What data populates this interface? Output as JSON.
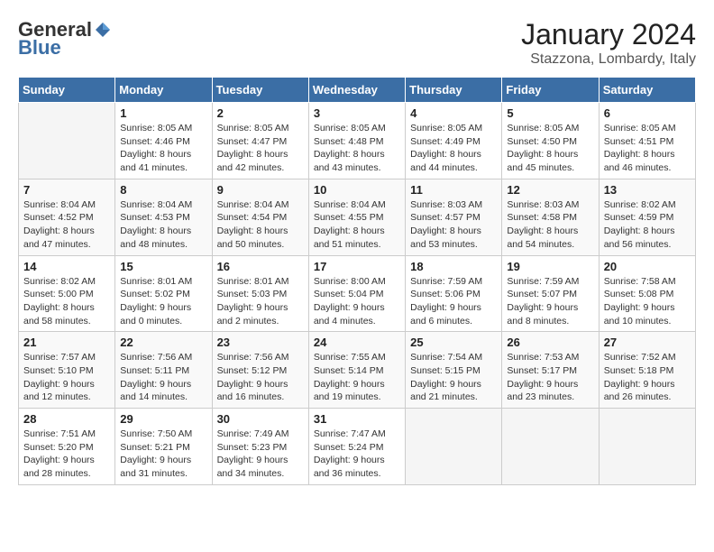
{
  "logo": {
    "general": "General",
    "blue": "Blue"
  },
  "title": "January 2024",
  "location": "Stazzona, Lombardy, Italy",
  "days_header": [
    "Sunday",
    "Monday",
    "Tuesday",
    "Wednesday",
    "Thursday",
    "Friday",
    "Saturday"
  ],
  "weeks": [
    [
      {
        "day": "",
        "sunrise": "",
        "sunset": "",
        "daylight": ""
      },
      {
        "day": "1",
        "sunrise": "Sunrise: 8:05 AM",
        "sunset": "Sunset: 4:46 PM",
        "daylight": "Daylight: 8 hours and 41 minutes."
      },
      {
        "day": "2",
        "sunrise": "Sunrise: 8:05 AM",
        "sunset": "Sunset: 4:47 PM",
        "daylight": "Daylight: 8 hours and 42 minutes."
      },
      {
        "day": "3",
        "sunrise": "Sunrise: 8:05 AM",
        "sunset": "Sunset: 4:48 PM",
        "daylight": "Daylight: 8 hours and 43 minutes."
      },
      {
        "day": "4",
        "sunrise": "Sunrise: 8:05 AM",
        "sunset": "Sunset: 4:49 PM",
        "daylight": "Daylight: 8 hours and 44 minutes."
      },
      {
        "day": "5",
        "sunrise": "Sunrise: 8:05 AM",
        "sunset": "Sunset: 4:50 PM",
        "daylight": "Daylight: 8 hours and 45 minutes."
      },
      {
        "day": "6",
        "sunrise": "Sunrise: 8:05 AM",
        "sunset": "Sunset: 4:51 PM",
        "daylight": "Daylight: 8 hours and 46 minutes."
      }
    ],
    [
      {
        "day": "7",
        "sunrise": "Sunrise: 8:04 AM",
        "sunset": "Sunset: 4:52 PM",
        "daylight": "Daylight: 8 hours and 47 minutes."
      },
      {
        "day": "8",
        "sunrise": "Sunrise: 8:04 AM",
        "sunset": "Sunset: 4:53 PM",
        "daylight": "Daylight: 8 hours and 48 minutes."
      },
      {
        "day": "9",
        "sunrise": "Sunrise: 8:04 AM",
        "sunset": "Sunset: 4:54 PM",
        "daylight": "Daylight: 8 hours and 50 minutes."
      },
      {
        "day": "10",
        "sunrise": "Sunrise: 8:04 AM",
        "sunset": "Sunset: 4:55 PM",
        "daylight": "Daylight: 8 hours and 51 minutes."
      },
      {
        "day": "11",
        "sunrise": "Sunrise: 8:03 AM",
        "sunset": "Sunset: 4:57 PM",
        "daylight": "Daylight: 8 hours and 53 minutes."
      },
      {
        "day": "12",
        "sunrise": "Sunrise: 8:03 AM",
        "sunset": "Sunset: 4:58 PM",
        "daylight": "Daylight: 8 hours and 54 minutes."
      },
      {
        "day": "13",
        "sunrise": "Sunrise: 8:02 AM",
        "sunset": "Sunset: 4:59 PM",
        "daylight": "Daylight: 8 hours and 56 minutes."
      }
    ],
    [
      {
        "day": "14",
        "sunrise": "Sunrise: 8:02 AM",
        "sunset": "Sunset: 5:00 PM",
        "daylight": "Daylight: 8 hours and 58 minutes."
      },
      {
        "day": "15",
        "sunrise": "Sunrise: 8:01 AM",
        "sunset": "Sunset: 5:02 PM",
        "daylight": "Daylight: 9 hours and 0 minutes."
      },
      {
        "day": "16",
        "sunrise": "Sunrise: 8:01 AM",
        "sunset": "Sunset: 5:03 PM",
        "daylight": "Daylight: 9 hours and 2 minutes."
      },
      {
        "day": "17",
        "sunrise": "Sunrise: 8:00 AM",
        "sunset": "Sunset: 5:04 PM",
        "daylight": "Daylight: 9 hours and 4 minutes."
      },
      {
        "day": "18",
        "sunrise": "Sunrise: 7:59 AM",
        "sunset": "Sunset: 5:06 PM",
        "daylight": "Daylight: 9 hours and 6 minutes."
      },
      {
        "day": "19",
        "sunrise": "Sunrise: 7:59 AM",
        "sunset": "Sunset: 5:07 PM",
        "daylight": "Daylight: 9 hours and 8 minutes."
      },
      {
        "day": "20",
        "sunrise": "Sunrise: 7:58 AM",
        "sunset": "Sunset: 5:08 PM",
        "daylight": "Daylight: 9 hours and 10 minutes."
      }
    ],
    [
      {
        "day": "21",
        "sunrise": "Sunrise: 7:57 AM",
        "sunset": "Sunset: 5:10 PM",
        "daylight": "Daylight: 9 hours and 12 minutes."
      },
      {
        "day": "22",
        "sunrise": "Sunrise: 7:56 AM",
        "sunset": "Sunset: 5:11 PM",
        "daylight": "Daylight: 9 hours and 14 minutes."
      },
      {
        "day": "23",
        "sunrise": "Sunrise: 7:56 AM",
        "sunset": "Sunset: 5:12 PM",
        "daylight": "Daylight: 9 hours and 16 minutes."
      },
      {
        "day": "24",
        "sunrise": "Sunrise: 7:55 AM",
        "sunset": "Sunset: 5:14 PM",
        "daylight": "Daylight: 9 hours and 19 minutes."
      },
      {
        "day": "25",
        "sunrise": "Sunrise: 7:54 AM",
        "sunset": "Sunset: 5:15 PM",
        "daylight": "Daylight: 9 hours and 21 minutes."
      },
      {
        "day": "26",
        "sunrise": "Sunrise: 7:53 AM",
        "sunset": "Sunset: 5:17 PM",
        "daylight": "Daylight: 9 hours and 23 minutes."
      },
      {
        "day": "27",
        "sunrise": "Sunrise: 7:52 AM",
        "sunset": "Sunset: 5:18 PM",
        "daylight": "Daylight: 9 hours and 26 minutes."
      }
    ],
    [
      {
        "day": "28",
        "sunrise": "Sunrise: 7:51 AM",
        "sunset": "Sunset: 5:20 PM",
        "daylight": "Daylight: 9 hours and 28 minutes."
      },
      {
        "day": "29",
        "sunrise": "Sunrise: 7:50 AM",
        "sunset": "Sunset: 5:21 PM",
        "daylight": "Daylight: 9 hours and 31 minutes."
      },
      {
        "day": "30",
        "sunrise": "Sunrise: 7:49 AM",
        "sunset": "Sunset: 5:23 PM",
        "daylight": "Daylight: 9 hours and 34 minutes."
      },
      {
        "day": "31",
        "sunrise": "Sunrise: 7:47 AM",
        "sunset": "Sunset: 5:24 PM",
        "daylight": "Daylight: 9 hours and 36 minutes."
      },
      {
        "day": "",
        "sunrise": "",
        "sunset": "",
        "daylight": ""
      },
      {
        "day": "",
        "sunrise": "",
        "sunset": "",
        "daylight": ""
      },
      {
        "day": "",
        "sunrise": "",
        "sunset": "",
        "daylight": ""
      }
    ]
  ]
}
